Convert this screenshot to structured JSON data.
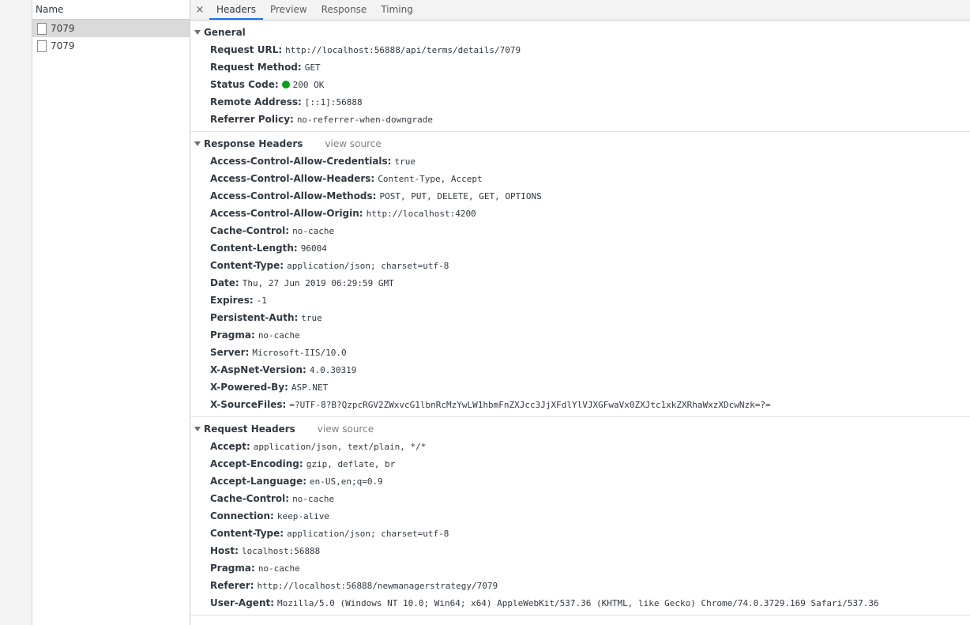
{
  "requests": {
    "header": "Name",
    "items": [
      {
        "name": "7079",
        "selected": true
      },
      {
        "name": "7079",
        "selected": false
      }
    ]
  },
  "tabs": {
    "close": "×",
    "items": [
      "Headers",
      "Preview",
      "Response",
      "Timing"
    ],
    "active": "Headers"
  },
  "general": {
    "title": "General",
    "rows": [
      {
        "key": "Request URL:",
        "value": "http://localhost:56888/api/terms/details/7079"
      },
      {
        "key": "Request Method:",
        "value": "GET"
      },
      {
        "key": "Status Code:",
        "value": "200 OK"
      },
      {
        "key": "Remote Address:",
        "value": "[::1]:56888"
      },
      {
        "key": "Referrer Policy:",
        "value": "no-referrer-when-downgrade"
      }
    ],
    "status_color": "#0a9e1a"
  },
  "response_headers": {
    "title": "Response Headers",
    "view_source": "view source",
    "rows": [
      {
        "key": "Access-Control-Allow-Credentials:",
        "value": "true"
      },
      {
        "key": "Access-Control-Allow-Headers:",
        "value": "Content-Type, Accept"
      },
      {
        "key": "Access-Control-Allow-Methods:",
        "value": "POST, PUT, DELETE, GET, OPTIONS"
      },
      {
        "key": "Access-Control-Allow-Origin:",
        "value": "http://localhost:4200"
      },
      {
        "key": "Cache-Control:",
        "value": "no-cache"
      },
      {
        "key": "Content-Length:",
        "value": "96004"
      },
      {
        "key": "Content-Type:",
        "value": "application/json; charset=utf-8"
      },
      {
        "key": "Date:",
        "value": "Thu, 27 Jun 2019 06:29:59 GMT"
      },
      {
        "key": "Expires:",
        "value": "-1"
      },
      {
        "key": "Persistent-Auth:",
        "value": "true"
      },
      {
        "key": "Pragma:",
        "value": "no-cache"
      },
      {
        "key": "Server:",
        "value": "Microsoft-IIS/10.0"
      },
      {
        "key": "X-AspNet-Version:",
        "value": "4.0.30319"
      },
      {
        "key": "X-Powered-By:",
        "value": "ASP.NET"
      },
      {
        "key": "X-SourceFiles:",
        "value": "=?UTF-8?B?QzpcRGV2ZWxvcG1lbnRcMzYwLW1hbmFnZXJcc3JjXFdlYlVJXGFwaVx0ZXJtc1xkZXRhaWxzXDcwNzk=?="
      }
    ]
  },
  "request_headers": {
    "title": "Request Headers",
    "view_source": "view source",
    "rows": [
      {
        "key": "Accept:",
        "value": "application/json, text/plain, */*"
      },
      {
        "key": "Accept-Encoding:",
        "value": "gzip, deflate, br"
      },
      {
        "key": "Accept-Language:",
        "value": "en-US,en;q=0.9"
      },
      {
        "key": "Cache-Control:",
        "value": "no-cache"
      },
      {
        "key": "Connection:",
        "value": "keep-alive"
      },
      {
        "key": "Content-Type:",
        "value": "application/json; charset=utf-8"
      },
      {
        "key": "Host:",
        "value": "localhost:56888"
      },
      {
        "key": "Pragma:",
        "value": "no-cache"
      },
      {
        "key": "Referer:",
        "value": "http://localhost:56888/newmanagerstrategy/7079"
      },
      {
        "key": "User-Agent:",
        "value": "Mozilla/5.0 (Windows NT 10.0; Win64; x64) AppleWebKit/537.36 (KHTML, like Gecko) Chrome/74.0.3729.169 Safari/537.36"
      }
    ]
  }
}
